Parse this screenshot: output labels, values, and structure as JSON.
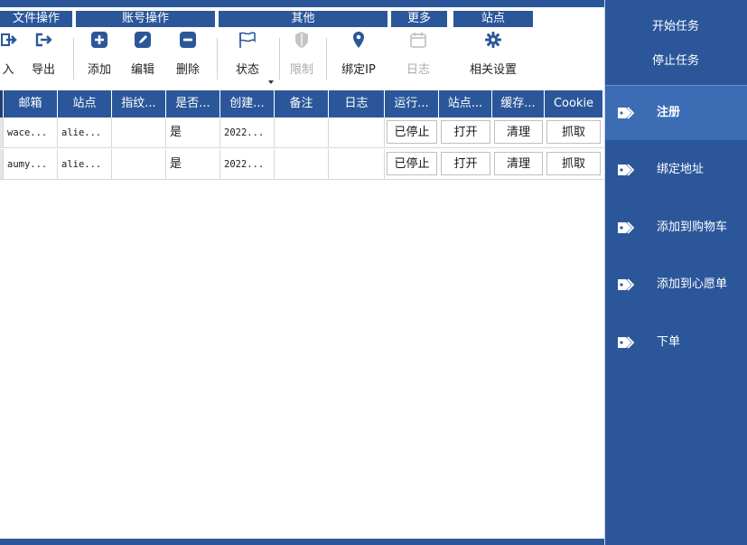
{
  "ribbon": {
    "groups": [
      {
        "title": "文件操作"
      },
      {
        "title": "账号操作"
      },
      {
        "title": "其他"
      },
      {
        "title": "更多"
      },
      {
        "title": "站点"
      }
    ],
    "buttons": {
      "import": "入",
      "export": "导出",
      "add": "添加",
      "edit": "编辑",
      "delete": "删除",
      "status": "状态",
      "limit": "限制",
      "bind_ip": "绑定IP",
      "log": "日志",
      "settings": "相关设置"
    }
  },
  "table": {
    "headers": [
      "邮箱",
      "站点",
      "指纹...",
      "是否...",
      "创建...",
      "备注",
      "日志",
      "运行...",
      "站点...",
      "缓存...",
      "Cookie"
    ],
    "rows": [
      {
        "email": "wace...",
        "site": "alie...",
        "fingerprint": "",
        "flag": "是",
        "created": "2022...",
        "note": "",
        "log": "",
        "run": "已停止",
        "open": "打开",
        "clean": "清理",
        "cookie": "抓取"
      },
      {
        "email": "aumy...",
        "site": "alie...",
        "fingerprint": "",
        "flag": "是",
        "created": "2022...",
        "note": "",
        "log": "",
        "run": "已停止",
        "open": "打开",
        "clean": "清理",
        "cookie": "抓取"
      }
    ]
  },
  "side": {
    "start": "开始任务",
    "stop": "停止任务",
    "nav": [
      "注册",
      "绑定地址",
      "添加到购物车",
      "添加到心愿单",
      "下单"
    ]
  },
  "colors": {
    "primary": "#2b579a",
    "active": "#3c6cb4"
  }
}
